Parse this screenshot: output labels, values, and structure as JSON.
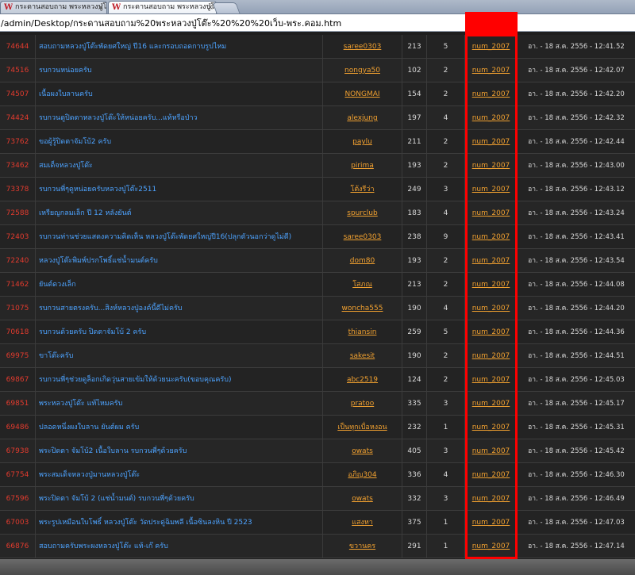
{
  "browser": {
    "tabs": [
      {
        "title": "กระดานสอบถาม พระหลวงปู่โต๊ะ",
        "active": false
      },
      {
        "title": "กระดานสอบถาม พระหลวงปู่โต๊ะ",
        "active": true
      }
    ],
    "url": "/admin/Desktop/กระดานสอบถาม%20พระหลวงปู่โต๊ะ%20%20%20เว็บ-พระ.คอม.htm"
  },
  "colors": {
    "background": "#1e1e1e",
    "id_color": "#e23b2e",
    "title_color": "#4da3ff",
    "user_link_color": "#f0a030",
    "highlight": "#ff0000"
  },
  "rows": [
    {
      "id": "74644",
      "title": "สอบถามหลวงปู่โต๊ะพัดยศใหญ่ ปี16 และกรอบถอดกาบรูปไหม",
      "user": "saree0303",
      "views": "213",
      "replies": "5",
      "last": "num_2007",
      "date": "อา. - 18 ส.ค. 2556 - 12:41.52"
    },
    {
      "id": "74516",
      "title": "รบกวนหน่อยครับ",
      "user": "nongya50",
      "views": "102",
      "replies": "2",
      "last": "num_2007",
      "date": "อา. - 18 ส.ค. 2556 - 12:42.07"
    },
    {
      "id": "74507",
      "title": "เนื้อผงใบลานครับ",
      "user": "NONGMAI",
      "views": "154",
      "replies": "2",
      "last": "num_2007",
      "date": "อา. - 18 ส.ค. 2556 - 12:42.20"
    },
    {
      "id": "74424",
      "title": "รบกวนดูปิดตาหลวงปู่โต๊ะให้หน่อยครับ...แท้หรือป่าว",
      "user": "alexjung",
      "views": "197",
      "replies": "4",
      "last": "num_2007",
      "date": "อา. - 18 ส.ค. 2556 - 12:42.32"
    },
    {
      "id": "73762",
      "title": "ขอผู้รู้ปิดตาจัมโบ้2 ครับ",
      "user": "paylu",
      "views": "211",
      "replies": "2",
      "last": "num_2007",
      "date": "อา. - 18 ส.ค. 2556 - 12:42.44"
    },
    {
      "id": "73462",
      "title": "สมเด็จหลวงปู่โต๊ะ",
      "user": "pirima",
      "views": "193",
      "replies": "2",
      "last": "num_2007",
      "date": "อา. - 18 ส.ค. 2556 - 12:43.00"
    },
    {
      "id": "73378",
      "title": "รบกวนพี่ๆดูหน่อยครับหลวงปู่โต๊ะ2511",
      "user": "โต้งรีว่า",
      "views": "249",
      "replies": "3",
      "last": "num_2007",
      "date": "อา. - 18 ส.ค. 2556 - 12:43.12"
    },
    {
      "id": "72588",
      "title": "เหรียญกลมเล็ก ปี 12 หลังยันต์",
      "user": "spurclub",
      "views": "183",
      "replies": "4",
      "last": "num_2007",
      "date": "อา. - 18 ส.ค. 2556 - 12:43.24"
    },
    {
      "id": "72403",
      "title": "รบกวนท่านช่วยแสดงความคิดเห็น หลวงปู่โต๊ะพัดยศใหญ่ปี16(ปลุกตัวนอกว่าดูไม่ดี)",
      "user": "saree0303",
      "views": "238",
      "replies": "9",
      "last": "num_2007",
      "date": "อา. - 18 ส.ค. 2556 - 12:43.41"
    },
    {
      "id": "72240",
      "title": "หลวงปู่โต๊ะพิมพ์ปรกโพธิ์แช่น้ำมนต์ครับ",
      "user": "dom80",
      "views": "193",
      "replies": "2",
      "last": "num_2007",
      "date": "อา. - 18 ส.ค. 2556 - 12:43.54"
    },
    {
      "id": "71462",
      "title": "ยันต์ดวงเล็ก",
      "user": "โสภณ",
      "views": "213",
      "replies": "2",
      "last": "num_2007",
      "date": "อา. - 18 ส.ค. 2556 - 12:44.08"
    },
    {
      "id": "71075",
      "title": "รบกวนสายตรงครับ...สิงห์หลวงปู่องค์นี้ดีไม่ครับ",
      "user": "woncha555",
      "views": "190",
      "replies": "4",
      "last": "num_2007",
      "date": "อา. - 18 ส.ค. 2556 - 12:44.20"
    },
    {
      "id": "70618",
      "title": "รบกวนด้วยครับ ปิดตาจัมโบ้ 2 ครับ",
      "user": "thiansin",
      "views": "259",
      "replies": "5",
      "last": "num_2007",
      "date": "อา. - 18 ส.ค. 2556 - 12:44.36"
    },
    {
      "id": "69975",
      "title": "ขาโต๊ะครับ",
      "user": "sakesit",
      "views": "190",
      "replies": "2",
      "last": "num_2007",
      "date": "อา. - 18 ส.ค. 2556 - 12:44.51"
    },
    {
      "id": "69867",
      "title": "รบกวนพี่ๆช่วยดูล็อกเกิดวุ่นสายเข้มให้ด้วยนะครับ(ขอบคุณครับ)",
      "user": "abc2519",
      "views": "124",
      "replies": "2",
      "last": "num_2007",
      "date": "อา. - 18 ส.ค. 2556 - 12:45.03"
    },
    {
      "id": "69851",
      "title": "พระหลวงปู่โต๊ะ แท้ไหมครับ",
      "user": "pratoo",
      "views": "335",
      "replies": "3",
      "last": "num_2007",
      "date": "อา. - 18 ส.ค. 2556 - 12:45.17"
    },
    {
      "id": "69486",
      "title": "ปลอดหนึ่งผงใบลาน ยันต์ผม ครับ",
      "user": "เป็นทุกเบื่อหงอน",
      "views": "232",
      "replies": "1",
      "last": "num_2007",
      "date": "อา. - 18 ส.ค. 2556 - 12:45.31"
    },
    {
      "id": "67938",
      "title": "พระปิดตา จัมโบ้2 เนื้อใบลาน รบกวนพี่ๆด้วยครับ",
      "user": "owats",
      "views": "405",
      "replies": "3",
      "last": "num_2007",
      "date": "อา. - 18 ส.ค. 2556 - 12:45.42"
    },
    {
      "id": "67754",
      "title": "พระสมเด็จหลวงปู่มานหลวงปู่โต๊ะ",
      "user": "อภิญ304",
      "views": "336",
      "replies": "4",
      "last": "num_2007",
      "date": "อา. - 18 ส.ค. 2556 - 12:46.30"
    },
    {
      "id": "67596",
      "title": "พระปิดตา จัมโบ้ 2 (แช่น้ำมนต์) รบกวนพี่ๆด้วยครับ",
      "user": "owats",
      "views": "332",
      "replies": "3",
      "last": "num_2007",
      "date": "อา. - 18 ส.ค. 2556 - 12:46.49"
    },
    {
      "id": "67003",
      "title": "พระรูปเหมือนใบโพธิ์ หลวงปู่โต๊ะ วัดประดู่ฉิมพลี เนื้อซินลงหิน ปี 2523",
      "user": "แสงหา",
      "views": "375",
      "replies": "1",
      "last": "num_2007",
      "date": "อา. - 18 ส.ค. 2556 - 12:47.03"
    },
    {
      "id": "66876",
      "title": "สอบถามครับพระผงหลวงปู่โต๊ะ แท้-เก๊ ครับ",
      "user": "ขวานคร",
      "views": "291",
      "replies": "1",
      "last": "num_2007",
      "date": "อา. - 18 ส.ค. 2556 - 12:47.14"
    }
  ]
}
